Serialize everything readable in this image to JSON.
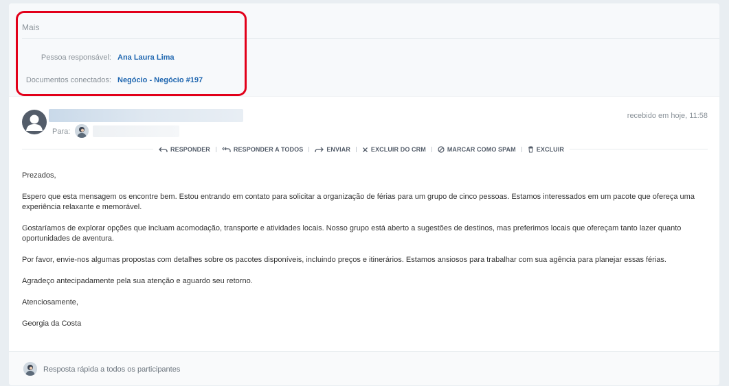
{
  "more_section": {
    "title": "Mais",
    "responsible_label": "Pessoa responsável:",
    "responsible_value": "Ana Laura Lima",
    "documents_label": "Documentos conectados:",
    "documents_value": "Negócio - Negócio #197"
  },
  "message": {
    "to_label": "Para:",
    "received": "recebido em hoje, 11:58",
    "actions": {
      "reply": "Responder",
      "reply_all": "Responder a todos",
      "forward": "Enviar",
      "delete_crm": "Excluir do CRM",
      "spam": "Marcar como spam",
      "delete": "Excluir"
    },
    "body": [
      "Prezados,",
      "Espero que esta mensagem os encontre bem. Estou entrando em contato para solicitar a organização de férias para um grupo de cinco pessoas. Estamos interessados em um pacote que ofereça uma experiência relaxante e memorável.",
      "Gostaríamos de explorar opções que incluam acomodação, transporte e atividades locais. Nosso grupo está aberto a sugestões de destinos, mas preferimos locais que ofereçam tanto lazer quanto oportunidades de aventura.",
      "Por favor, envie-nos algumas propostas com detalhes sobre os pacotes disponíveis, incluindo preços e itinerários. Estamos ansiosos para trabalhar com sua agência para planejar essas férias.",
      "Agradeço antecipadamente pela sua atenção e aguardo seu retorno.",
      "Atenciosamente,",
      "Georgia da Costa"
    ]
  },
  "quick_reply": {
    "placeholder": "Resposta rápida a todos os participantes"
  },
  "colors": {
    "link": "#2067b0",
    "highlight": "#e2001a",
    "muted": "#8a9299"
  }
}
